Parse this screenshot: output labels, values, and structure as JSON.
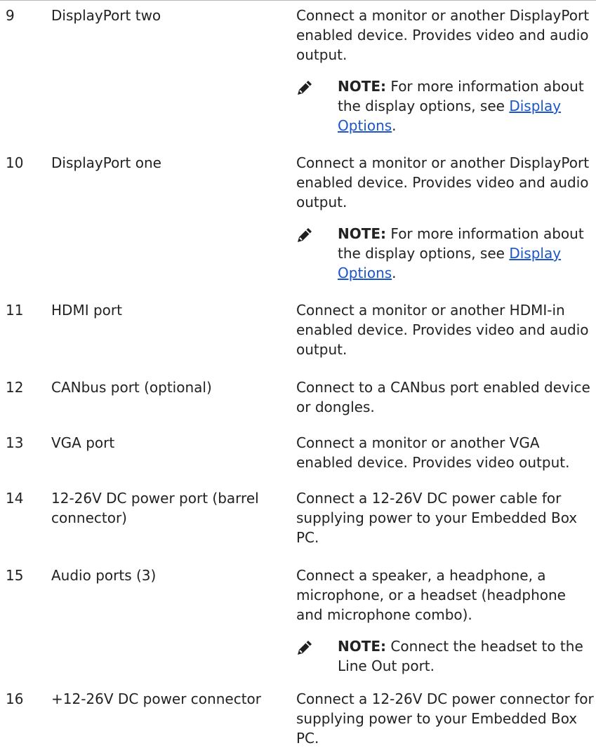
{
  "rows": [
    {
      "number": "9",
      "name": "DisplayPort two",
      "description": "Connect a monitor or another DisplayPort enabled device. Provides video and audio output.",
      "note": {
        "label": "NOTE:",
        "text": "For more information about the display options, see",
        "link": "Display Options",
        "after_link": "."
      }
    },
    {
      "number": "10",
      "name": "DisplayPort one",
      "description": "Connect a monitor or another DisplayPort enabled device. Provides video and audio output.",
      "note": {
        "label": "NOTE:",
        "text": "For more information about the display options, see",
        "link": "Display Options",
        "after_link": "."
      }
    },
    {
      "number": "11",
      "name": "HDMI port",
      "description": "Connect a monitor or another HDMI-in enabled device. Provides video and audio output."
    },
    {
      "number": "12",
      "name": "CANbus port (optional)",
      "description": "Connect to a CANbus port enabled device or dongles."
    },
    {
      "number": "13",
      "name": "VGA port",
      "description": "Connect a monitor or another VGA enabled device. Provides video output."
    },
    {
      "number": "14",
      "name": "12-26V DC power port (barrel connector)",
      "description": "Connect a 12-26V DC power cable for supplying power to your Embedded Box PC."
    },
    {
      "number": "15",
      "name": "Audio ports (3)",
      "description": "Connect a speaker, a headphone, a microphone, or a headset (headphone and microphone combo).",
      "note": {
        "label": "NOTE:",
        "text": "Connect the headset to the Line Out port."
      }
    },
    {
      "number": "16",
      "name": "+12-26V DC power connector",
      "description": "Connect a 12-26V DC power connector for supplying power to your Embedded Box PC."
    }
  ]
}
